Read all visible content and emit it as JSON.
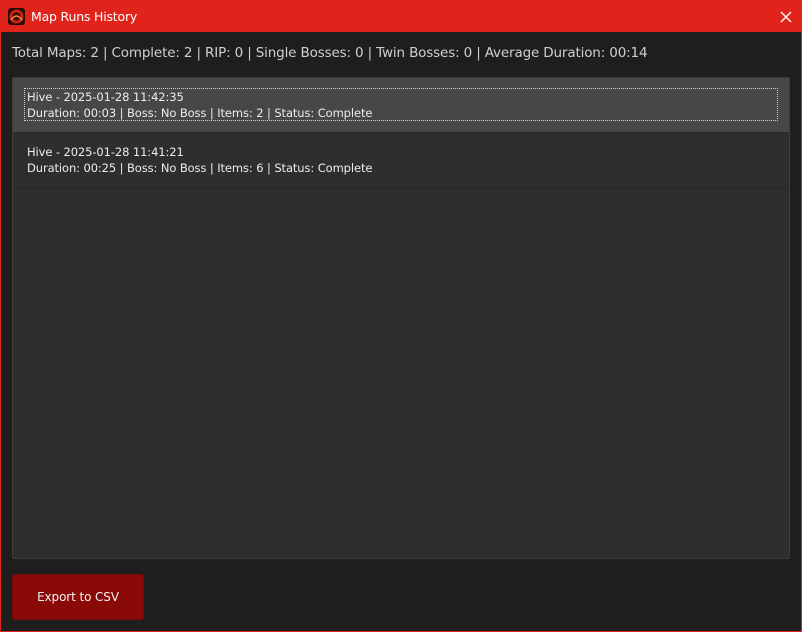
{
  "window": {
    "title": "Map Runs History",
    "icon": "app-logo-icon",
    "accent_color": "#e0241c"
  },
  "summary": {
    "text": "Total Maps: 2 | Complete: 2 | RIP: 0 | Single Bosses: 0 | Twin Bosses: 0 | Average Duration: 00:14"
  },
  "runs": [
    {
      "title": "Hive - 2025-01-28 11:42:35",
      "details": "Duration: 00:03 | Boss: No Boss | Items: 2 | Status: Complete",
      "selected": true
    },
    {
      "title": "Hive - 2025-01-28 11:41:21",
      "details": "Duration: 00:25 | Boss: No Boss | Items: 6 | Status: Complete",
      "selected": false
    }
  ],
  "actions": {
    "export_label": "Export to CSV",
    "export_color": "#8a0a08"
  }
}
